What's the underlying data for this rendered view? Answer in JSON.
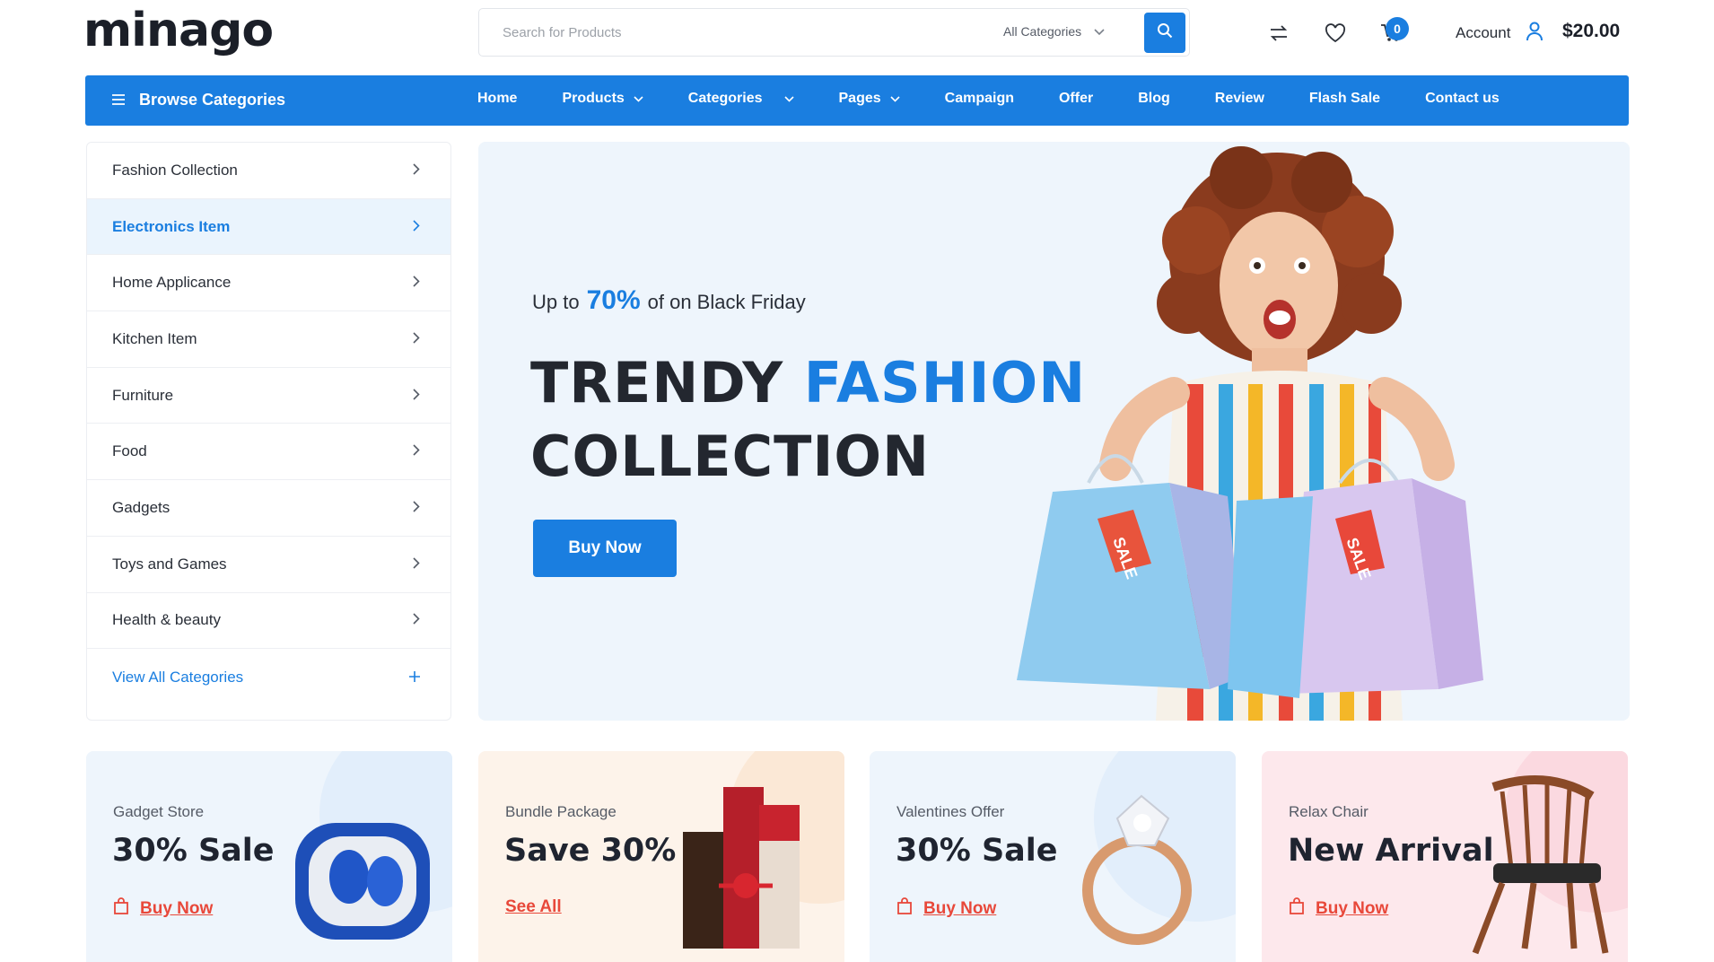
{
  "brand": {
    "logo_text": "minago"
  },
  "search": {
    "placeholder": "Search for Products",
    "category_label": "All Categories"
  },
  "header": {
    "cart_count": "0",
    "account_label": "Account",
    "cart_total": "$20.00",
    "icons": [
      "compare-icon",
      "heart-icon",
      "cart-icon",
      "user-icon",
      "search-icon"
    ]
  },
  "nav": {
    "browse_label": "Browse Categories",
    "items": [
      {
        "label": "Home"
      },
      {
        "label": "Products"
      },
      {
        "label": "Categories"
      },
      {
        "label": "Pages"
      },
      {
        "label": "Campaign"
      },
      {
        "label": "Offer"
      },
      {
        "label": "Blog"
      },
      {
        "label": "Review"
      },
      {
        "label": "Flash Sale"
      },
      {
        "label": "Contact us"
      }
    ]
  },
  "sidebar": {
    "items": [
      {
        "label": "Fashion Collection"
      },
      {
        "label": "Electronics Item"
      },
      {
        "label": "Home Applicance"
      },
      {
        "label": "Kitchen Item"
      },
      {
        "label": "Furniture"
      },
      {
        "label": "Food"
      },
      {
        "label": "Gadgets"
      },
      {
        "label": "Toys and Games"
      },
      {
        "label": "Health & beauty"
      }
    ],
    "view_all": "View All Categories",
    "active_index": 1
  },
  "hero": {
    "promo_prefix": "Up to",
    "promo_percent": "70%",
    "promo_suffix": "of on Black Friday",
    "title_word1": "TRENDY",
    "title_word2": "FASHION",
    "title_line2": "COLLECTION",
    "cta": "Buy Now",
    "sale_tag": "SALE"
  },
  "cards": [
    {
      "subtitle": "Gadget Store",
      "headline": "30% Sale",
      "link": "Buy Now",
      "bg": "#eef5fc"
    },
    {
      "subtitle": "Bundle Package",
      "headline": "Save 30%",
      "link": "See All",
      "bg": "#fdf3ea"
    },
    {
      "subtitle": "Valentines Offer",
      "headline": "30% Sale",
      "link": "Buy Now",
      "bg": "#eef5fc"
    },
    {
      "subtitle": "Relax Chair",
      "headline": "New Arrival",
      "link": "Buy Now",
      "bg": "#fde8ec"
    }
  ],
  "colors": {
    "accent": "#1a7ee0",
    "link_red": "#e8483a"
  }
}
